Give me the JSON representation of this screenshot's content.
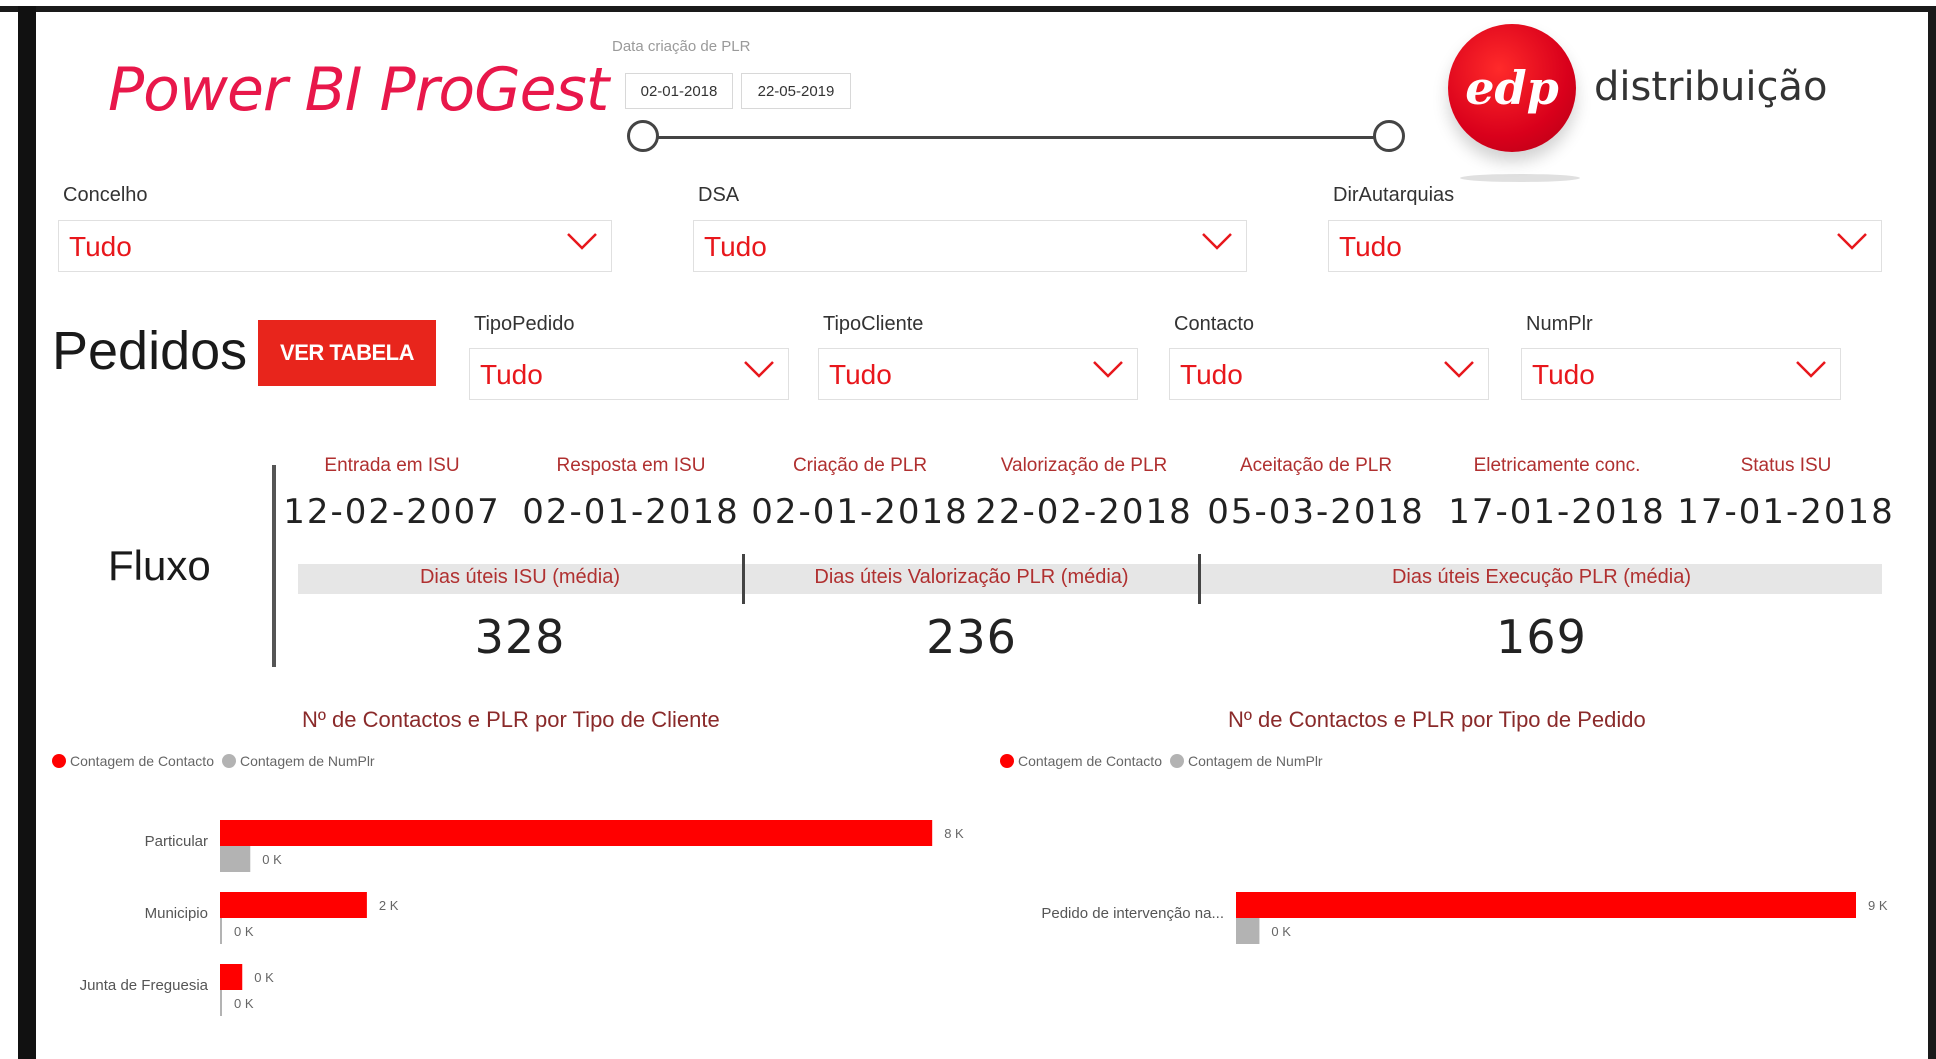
{
  "header": {
    "app_title": "Power BI ProGest",
    "date_filter": {
      "label": "Data criação de PLR",
      "start": "02-01-2018",
      "end": "22-05-2019"
    },
    "brand": {
      "logo_text": "edp",
      "name": "distribuição"
    }
  },
  "filters_row1": [
    {
      "label": "Concelho",
      "value": "Tudo"
    },
    {
      "label": "DSA",
      "value": "Tudo"
    },
    {
      "label": "DirAutarquias",
      "value": "Tudo"
    }
  ],
  "pedidos": {
    "title": "Pedidos",
    "button_label": "VER TABELA",
    "filters": [
      {
        "label": "TipoPedido",
        "value": "Tudo"
      },
      {
        "label": "TipoCliente",
        "value": "Tudo"
      },
      {
        "label": "Contacto",
        "value": "Tudo"
      },
      {
        "label": "NumPlr",
        "value": "Tudo"
      }
    ]
  },
  "fluxo": {
    "title": "Fluxo",
    "stages": [
      {
        "label": "Entrada em ISU",
        "date": "12-02-2007"
      },
      {
        "label": "Resposta em ISU",
        "date": "02-01-2018"
      },
      {
        "label": "Criação de PLR",
        "date": "02-01-2018"
      },
      {
        "label": "Valorização de PLR",
        "date": "22-02-2018"
      },
      {
        "label": "Aceitação de PLR",
        "date": "05-03-2018"
      },
      {
        "label": "Eletricamente conc.",
        "date": "17-01-2018"
      },
      {
        "label": "Status ISU",
        "date": "17-01-2018"
      }
    ],
    "averages": [
      {
        "label": "Dias úteis ISU (média)",
        "value": "328"
      },
      {
        "label": "Dias úteis Valorização PLR (média)",
        "value": "236"
      },
      {
        "label": "Dias úteis Execução PLR (média)",
        "value": "169"
      }
    ]
  },
  "colors": {
    "accent": "#e8171c",
    "secondary": "#b3b3b3",
    "title": "#e8174a"
  },
  "chart_data": [
    {
      "type": "bar",
      "orientation": "horizontal",
      "title": "Nº de Contactos e PLR por Tipo de Cliente",
      "categories": [
        "Particular",
        "Municipio",
        "Junta de Freguesia"
      ],
      "series": [
        {
          "name": "Contagem de Contacto",
          "color": "#ff0000",
          "values": [
            8000,
            1650,
            250
          ],
          "labels": [
            "8 K",
            "2 K",
            "0 K"
          ]
        },
        {
          "name": "Contagem de NumPlr",
          "color": "#b3b3b3",
          "values": [
            340,
            20,
            20
          ],
          "labels": [
            "0 K",
            "0 K",
            "0 K"
          ]
        }
      ],
      "xlim": [
        0,
        8200
      ],
      "legend": "top-left"
    },
    {
      "type": "bar",
      "orientation": "horizontal",
      "title": "Nº de Contactos e PLR por Tipo de Pedido",
      "categories": [
        "Pedido de intervenção na..."
      ],
      "series": [
        {
          "name": "Contagem de Contacto",
          "color": "#ff0000",
          "values": [
            9000
          ],
          "labels": [
            "9 K"
          ]
        },
        {
          "name": "Contagem de NumPlr",
          "color": "#b3b3b3",
          "values": [
            340
          ],
          "labels": [
            "0 K"
          ]
        }
      ],
      "xlim": [
        0,
        9000
      ],
      "legend": "top-left"
    }
  ]
}
